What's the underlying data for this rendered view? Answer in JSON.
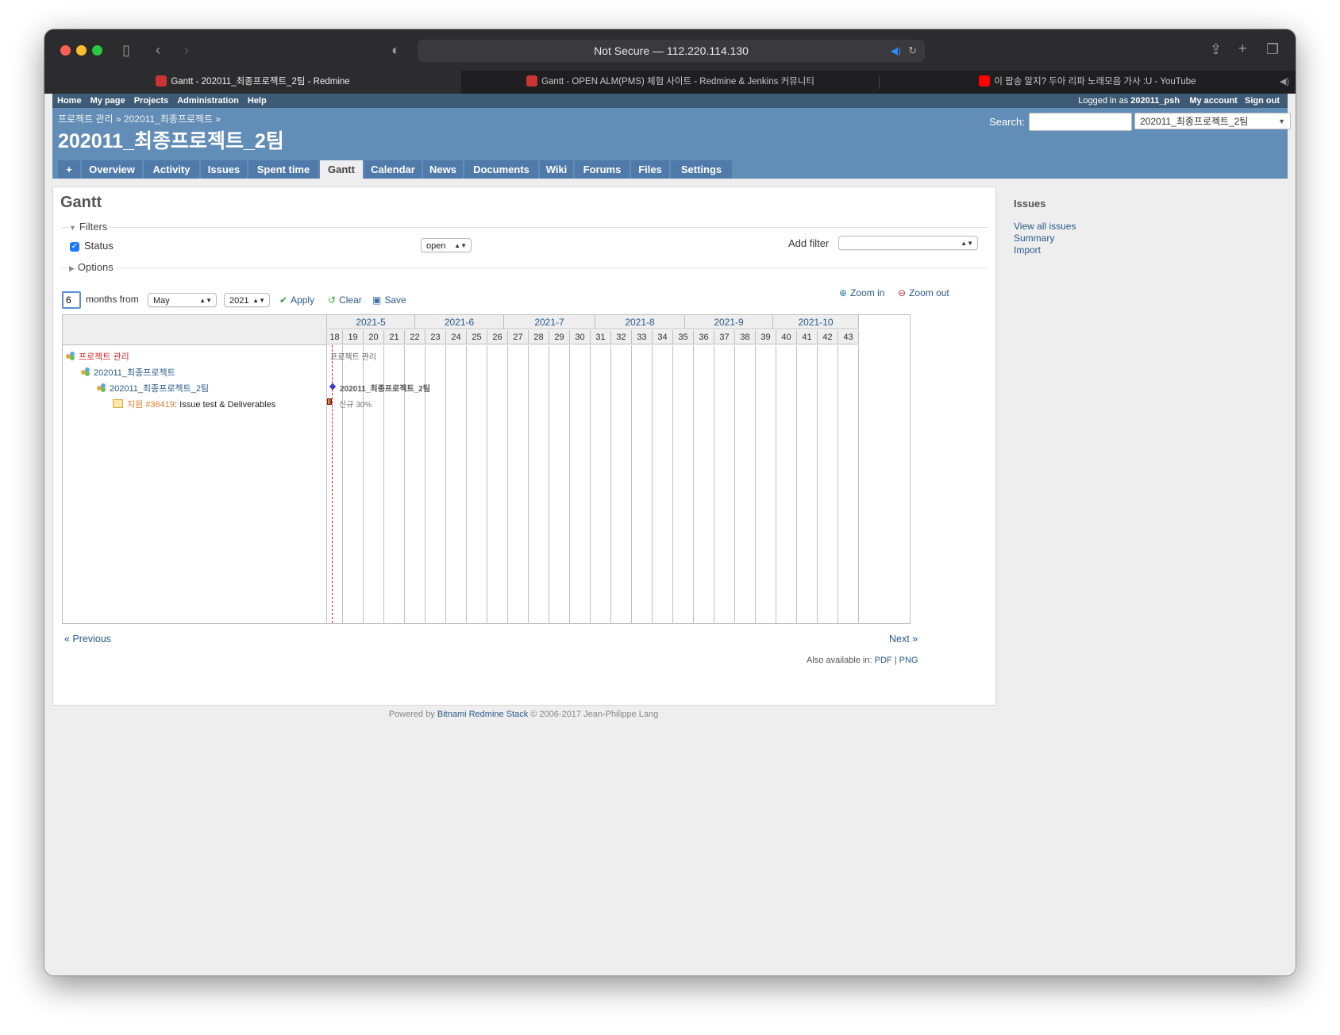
{
  "browser": {
    "address": "Not Secure — 112.220.114.130",
    "tabs": [
      {
        "title": "Gantt - 202011_최종프로젝트_2팀 - Redmine"
      },
      {
        "title": "Gantt - OPEN ALM(PMS) 체험 사이트 - Redmine & Jenkins 커뮤니티"
      },
      {
        "title": "이 팝송 알지? 두아 리파 노래모음 가사 :U - YouTube"
      }
    ]
  },
  "top_menu": {
    "home": "Home",
    "my_page": "My page",
    "projects": "Projects",
    "administration": "Administration",
    "help": "Help",
    "logged_in_as": "Logged in as",
    "user": "202011_psh",
    "my_account": "My account",
    "sign_out": "Sign out"
  },
  "header": {
    "breadcrumb": "프로젝트 관리 » 202011_최종프로젝트 »",
    "title": "202011_최종프로젝트_2팀",
    "search_label": "Search:",
    "project_jump": "202011_최종프로젝트_2팀"
  },
  "main_menu": {
    "tabs": [
      "+",
      "Overview",
      "Activity",
      "Issues",
      "Spent time",
      "Gantt",
      "Calendar",
      "News",
      "Documents",
      "Wiki",
      "Forums",
      "Files",
      "Settings"
    ],
    "selected": "Gantt"
  },
  "gantt": {
    "heading": "Gantt",
    "filters_legend": "Filters",
    "status_label": "Status",
    "status_operator": "open",
    "add_filter_label": "Add filter",
    "options_legend": "Options",
    "months_value": "6",
    "months_from_label": "months from",
    "month_select": "May",
    "year_select": "2021",
    "apply": "Apply",
    "clear": "Clear",
    "save": "Save",
    "zoom_in": "Zoom in",
    "zoom_out": "Zoom out",
    "months": [
      "2021-5",
      "2021-6",
      "2021-7",
      "2021-8",
      "2021-9",
      "2021-10"
    ],
    "weeks": [
      "18",
      "19",
      "20",
      "21",
      "22",
      "23",
      "24",
      "25",
      "26",
      "27",
      "28",
      "29",
      "30",
      "31",
      "32",
      "33",
      "34",
      "35",
      "36",
      "37",
      "38",
      "39",
      "40",
      "41",
      "42",
      "43"
    ],
    "rows": [
      {
        "name": "프로젝트 관리",
        "bar_label": "프로젝트 관리"
      },
      {
        "name": "202011_최종프로젝트"
      },
      {
        "name": "202011_최종프로젝트_2팀",
        "bar_label": "202011_최종프로젝트_2팀"
      },
      {
        "tracker": "지원",
        "issue": "#36419",
        "subject": ": Issue test & Deliverables",
        "bar_status": "신규",
        "bar_progress": "30%"
      }
    ],
    "previous": "« Previous",
    "next": "Next »",
    "also_available": "Also available in:",
    "pdf": "PDF",
    "sep": "|",
    "png": "PNG"
  },
  "sidebar": {
    "heading": "Issues",
    "links": [
      "View all issues",
      "Summary",
      "Import"
    ]
  },
  "footer": {
    "powered_by": "Powered by",
    "stack": "Bitnami Redmine Stack",
    "copyright": "© 2006-2017 Jean-Philippe Lang"
  }
}
